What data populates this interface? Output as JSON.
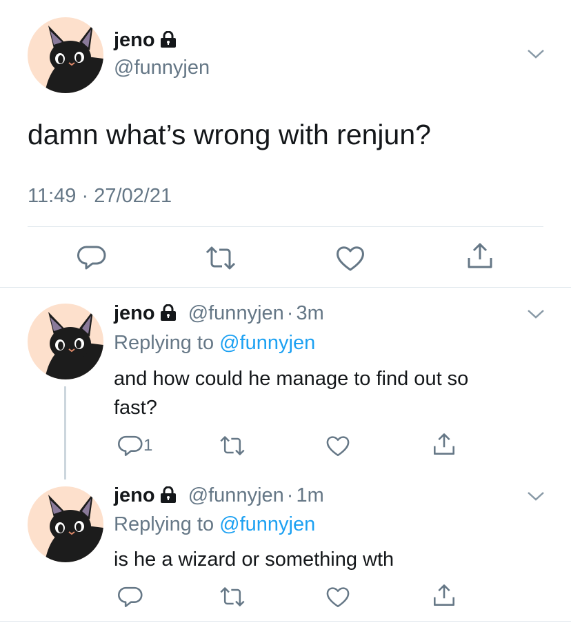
{
  "main_tweet": {
    "name": "jeno",
    "handle": "@funnyjen",
    "text": "damn what’s wrong with renjun?",
    "timestamp": "11:49 · 27/02/21"
  },
  "replies": [
    {
      "name": "jeno",
      "handle": "@funnyjen",
      "dot": "·",
      "time": "3m",
      "replying_prefix": "Replying to ",
      "replying_to": "@funnyjen",
      "text_line1": "and how could he manage to find out so",
      "text_line2": "fast?",
      "reply_count": "1"
    },
    {
      "name": "jeno",
      "handle": "@funnyjen",
      "dot": "·",
      "time": "1m",
      "replying_prefix": "Replying to ",
      "replying_to": "@funnyjen",
      "text_line1": "is he a wizard or something wth"
    }
  ],
  "icons": [
    "lock-icon",
    "chevron-down-icon",
    "reply-icon",
    "retweet-icon",
    "like-icon",
    "share-icon"
  ],
  "colors": {
    "text": "#14171a",
    "secondary": "#657786",
    "link": "#1da1f2",
    "avatar_bg": "#fde0cc"
  }
}
